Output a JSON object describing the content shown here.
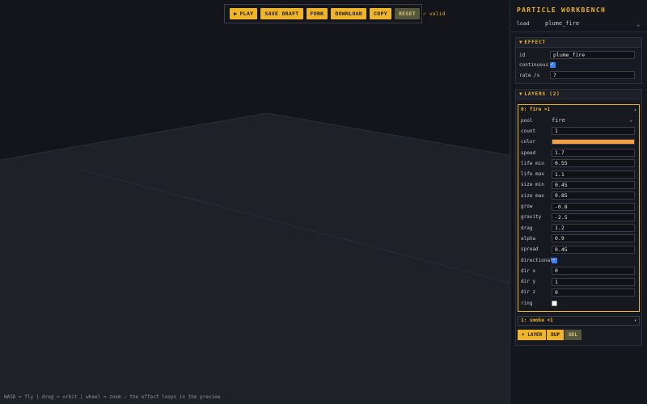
{
  "toolbar": {
    "play": "PLAY",
    "save_draft": "SAVE DRAFT",
    "fork": "FORK",
    "download": "DOWNLOAD",
    "copy": "COPY",
    "reset": "RESET",
    "status": "✓ valid"
  },
  "hint": "WASD = fly | drag = orbit | wheel = zoom — the effect loops in the preview",
  "panel": {
    "title": "PARTICLE WORKBENCH",
    "load_label": "load",
    "load_value": "plume_fire"
  },
  "effect": {
    "heading": "EFFECT",
    "id_label": "id",
    "id_value": "plume_fire",
    "continuous_label": "continuous",
    "continuous": true,
    "rate_label": "rate /s",
    "rate_value": "7"
  },
  "layers": {
    "heading": "LAYERS (2)",
    "expanded": {
      "title": "0: fire ×1",
      "fields": [
        {
          "label": "pool",
          "value": "fire",
          "type": "select"
        },
        {
          "label": "count",
          "value": "1",
          "type": "input"
        },
        {
          "label": "color",
          "value": "#f5a040",
          "type": "color"
        },
        {
          "label": "speed",
          "value": "1.7",
          "type": "input"
        },
        {
          "label": "life min",
          "value": "0.55",
          "type": "input"
        },
        {
          "label": "life max",
          "value": "1.1",
          "type": "input"
        },
        {
          "label": "size min",
          "value": "0.45",
          "type": "input"
        },
        {
          "label": "size max",
          "value": "0.85",
          "type": "input"
        },
        {
          "label": "grow",
          "value": "-0.8",
          "type": "input"
        },
        {
          "label": "gravity",
          "value": "-2.5",
          "type": "input"
        },
        {
          "label": "drag",
          "value": "1.2",
          "type": "input"
        },
        {
          "label": "alpha",
          "value": "0.9",
          "type": "input"
        },
        {
          "label": "spread",
          "value": "0.45",
          "type": "input"
        },
        {
          "label": "directional",
          "value": true,
          "type": "checkbox"
        },
        {
          "label": "dir x",
          "value": "0",
          "type": "input"
        },
        {
          "label": "dir y",
          "value": "1",
          "type": "input"
        },
        {
          "label": "dir z",
          "value": "0",
          "type": "input"
        },
        {
          "label": "ring",
          "value": false,
          "type": "checkbox"
        }
      ]
    },
    "collapsed": {
      "title": "1: smoke ×1"
    },
    "add_label": "+ LAYER",
    "dup_label": "DUP",
    "del_label": "DEL"
  },
  "colors": {
    "accent": "#f0b429",
    "panel_bg": "#15171e",
    "viewport_bg": "#13151b"
  }
}
